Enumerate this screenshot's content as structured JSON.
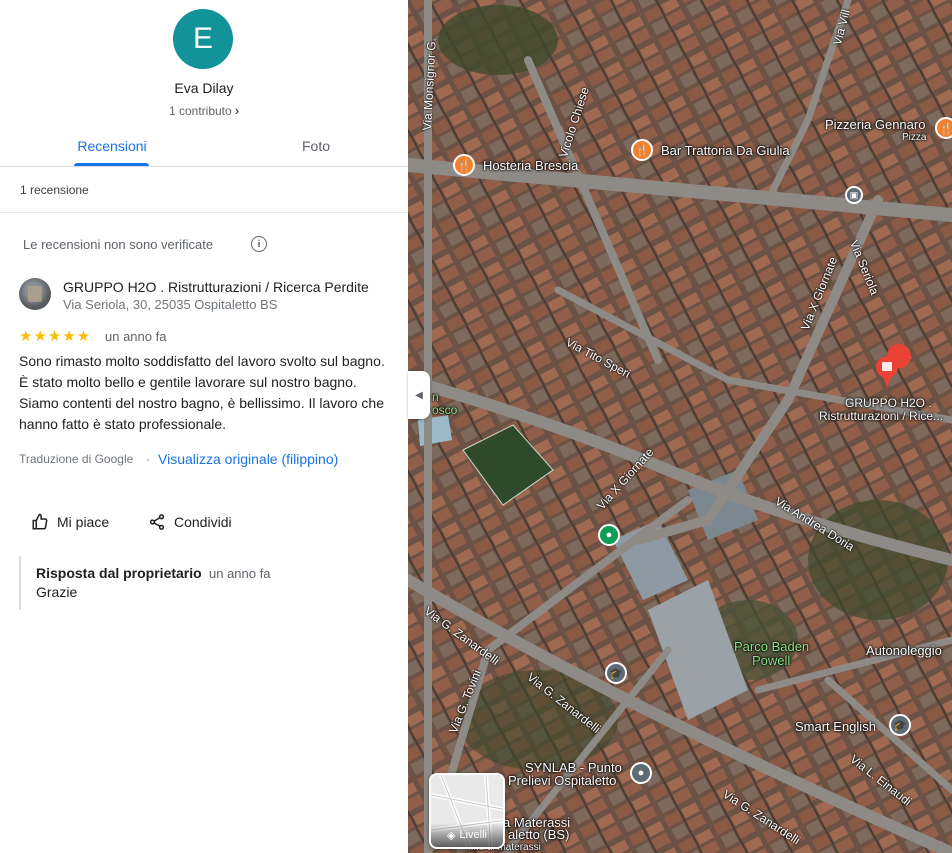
{
  "profile": {
    "initial": "E",
    "name": "Eva Dilay",
    "contributions": "1 contributo",
    "avatar_color": "#12939a"
  },
  "tabs": [
    {
      "label": "Recensioni",
      "active": true
    },
    {
      "label": "Foto",
      "active": false
    }
  ],
  "review_count": "1 recensione",
  "notice": "Le recensioni non sono verificate",
  "review": {
    "business_name": "GRUPPO H2O . Ristrutturazioni / Ricerca Perdite",
    "business_address": "Via Seriola, 30, 25035 Ospitaletto BS",
    "stars": "★★★★★",
    "rating": 5,
    "time": "un anno fa",
    "text": "Sono rimasto molto soddisfatto del lavoro svolto sul bagno. È stato molto bello e gentile lavorare sul nostro bagno. Siamo contenti del nostro bagno, è bellissimo. Il lavoro che hanno fatto è stato professionale.",
    "translated_by": "Traduzione di Google",
    "separator": "·",
    "view_original": "Visualizza originale (filippino)",
    "like_label": "Mi piace",
    "share_label": "Condividi",
    "owner_reply": {
      "title": "Risposta dal proprietario",
      "time": "un anno fa",
      "text": "Grazie"
    }
  },
  "map": {
    "places": {
      "hosteria": "Hosteria Brescia",
      "trattoria": "Bar Trattoria Da Giulia",
      "pizzeria": "Pizzeria Gennaro",
      "pizza": "Pizza",
      "gruppo_line1": "GRUPPO H2O .",
      "gruppo_line2": "Ristrutturazioni / Rice...",
      "parco_line1": "Parco Baden",
      "parco_line2": "Powell",
      "autonoleggio": "Autonoleggio",
      "smart_english": "Smart English",
      "synlab_line1": "SYNLAB - Punto",
      "synlab_line2": "Prelievi Ospitaletto",
      "materassi_line1": "a Materassi",
      "materassi_line2": "aletto (BS)",
      "materassi_line3": "...io di materassi",
      "partial_bosco1": "n",
      "partial_bosco2": "osco"
    },
    "streets": {
      "monsignor": "Via Monsignor G.",
      "vicolo_chiese": "Vicolo Chiese",
      "via_x_giornate_top": "Via X Giornate",
      "via_seriola": "Via Seriola",
      "tito_speri": "Via Tito Speri",
      "via_x_giornate_mid": "Via X Giornate",
      "andrea_doria": "Via Andrea Doria",
      "zanardelli_1": "Via G. Zanardelli",
      "zanardelli_2": "Via G. Zanardelli",
      "zanardelli_3": "Via G. Zanardelli",
      "tovini": "Via G. Tovini",
      "einaudi": "Via L. Einaudi",
      "villa": "Via Vill"
    },
    "layers_label": "Livelli"
  }
}
